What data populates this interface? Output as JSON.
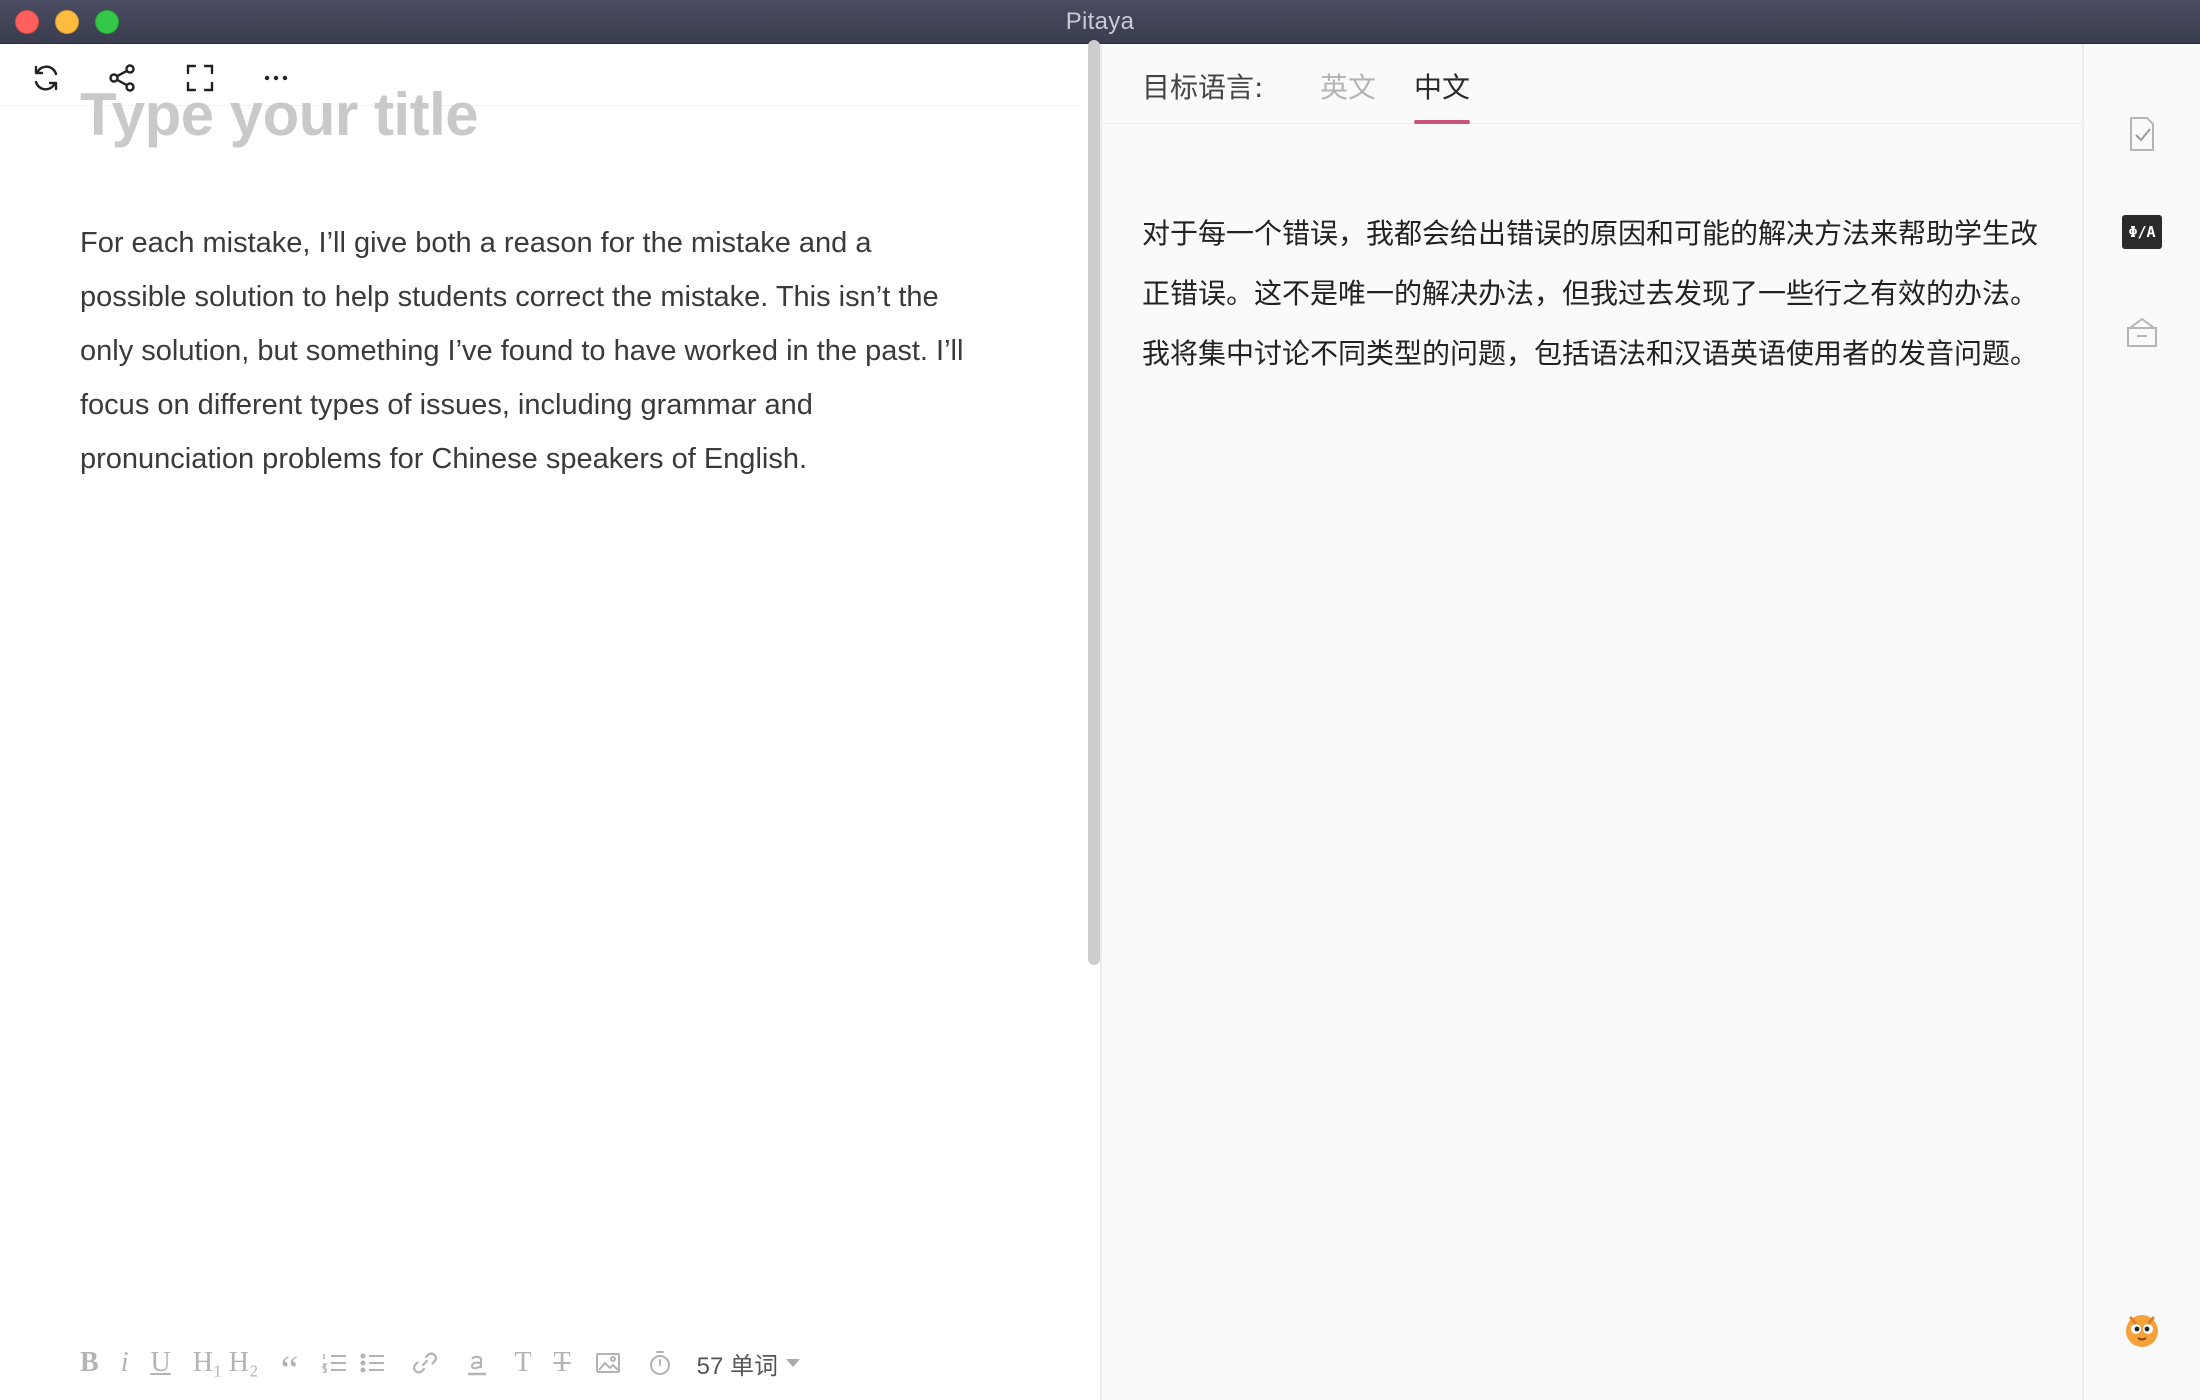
{
  "window": {
    "title": "Pitaya"
  },
  "editor": {
    "title_placeholder": "Type your title",
    "body": "For each mistake, I’ll give both a reason for the mistake and a possible solution to help students correct the mistake. This isn’t the only solution, but something I’ve found to have worked in the past. I’ll focus on different types of issues, including grammar and pronunciation problems for Chinese speakers of English.",
    "top_toolbar": [
      "refresh-icon",
      "share-icon",
      "fullscreen-icon",
      "more-icon"
    ],
    "format_toolbar": {
      "bold": "B",
      "italic": "i",
      "underline": "U",
      "h1": "H₁",
      "h2": "H₂",
      "quote": "“",
      "text_style": "T",
      "clear_format": "T",
      "word_count": "57 单词"
    }
  },
  "translation": {
    "target_label": "目标语言:",
    "tabs": [
      {
        "label": "英文",
        "active": false
      },
      {
        "label": "中文",
        "active": true
      }
    ],
    "text": "对于每一个错误，我都会给出错误的原因和可能的解决方法来帮助学生改正错误。这不是唯一的解决办法，但我过去发现了一些行之有效的办法。我将集中讨论不同类型的问题，包括语法和汉语英语使用者的发音问题。",
    "accent_color": "#c8547a"
  },
  "sidebar": {
    "translate_badge": "Φ/A",
    "icons": [
      "check-document-icon",
      "translate-icon",
      "inbox-icon",
      "mascot-icon"
    ]
  }
}
